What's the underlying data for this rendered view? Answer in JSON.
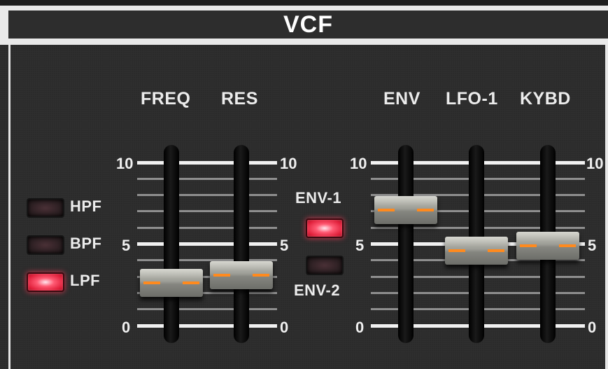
{
  "module": {
    "title": "VCF"
  },
  "filter_types": [
    {
      "label": "HPF",
      "active": false
    },
    {
      "label": "BPF",
      "active": false
    },
    {
      "label": "LPF",
      "active": true
    }
  ],
  "env_select": [
    {
      "label": "ENV-1",
      "active": true
    },
    {
      "label": "ENV-2",
      "active": false
    }
  ],
  "scale": {
    "max": "10",
    "mid": "5",
    "min": "0"
  },
  "sliders": [
    {
      "label": "FREQ",
      "value": 2.6
    },
    {
      "label": "RES",
      "value": 3.1
    },
    {
      "label": "ENV",
      "value": 7.1
    },
    {
      "label": "LFO-1",
      "value": 4.6
    },
    {
      "label": "KYBD",
      "value": 4.9
    }
  ],
  "colors": {
    "led_on": "#ff3b58",
    "accent_line": "#ff8a1e",
    "panel": "#2b2b2b"
  }
}
